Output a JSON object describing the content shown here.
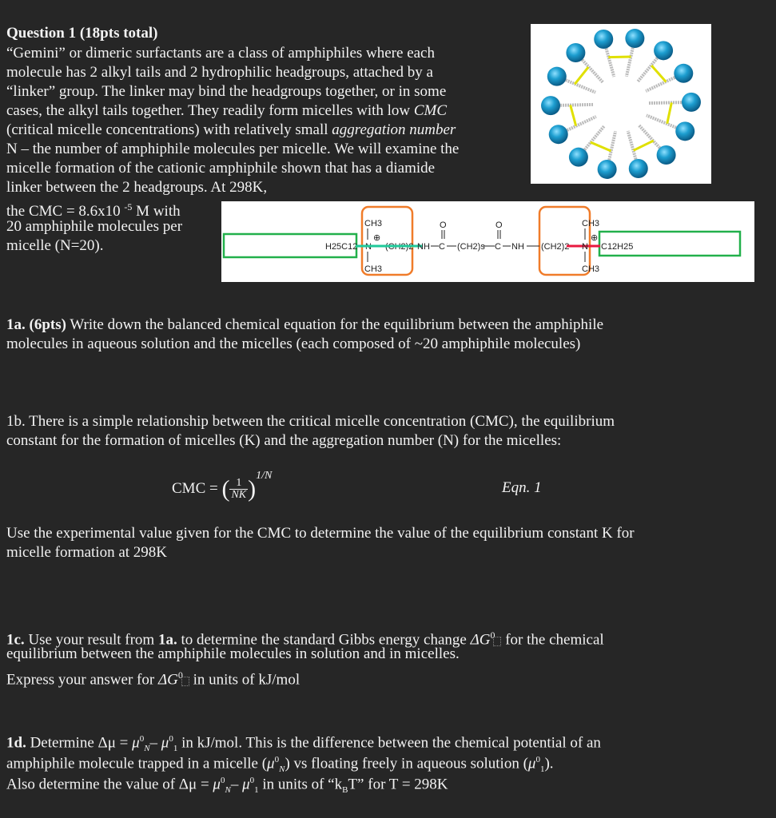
{
  "question": {
    "title": "Question 1 (18pts total)",
    "intro_lines": [
      "“Gemini” or dimeric surfactants are a class of amphiphiles where each",
      "molecule has 2 alkyl tails and 2 hydrophilic headgroups, attached by a",
      "“linker” group. The linker may bind the headgroups together, or in some",
      "cases, the alkyl tails together. They readily form micelles with low ",
      "(critical micelle concentrations) with relatively small ",
      "N – the number of amphiphile molecules per micelle.  We will examine the",
      "micelle formation of the cationic amphiphile shown that has a diamide",
      "linker between the 2 headgroups. At 298K,"
    ],
    "intro_italic": {
      "cmc": "CMC",
      "aggregation": "aggregation number"
    },
    "cmc_line_prefix": "the CMC = 8.6x10 ",
    "cmc_exponent": "-5",
    "cmc_line_suffix": " M with",
    "n_line_1": "20 amphiphile molecules per",
    "n_line_2": "micelle (N=20).",
    "cmc_value": "8.6x10^-5 M",
    "aggregation_number": 20,
    "temperature": "298K"
  },
  "figures": {
    "micelle_image": "gemini-micelle-diagram",
    "molecule": {
      "left_tail": "H25C12",
      "right_tail": "C12H25",
      "methyl": "CH3",
      "nitrogen": "N",
      "charge": "⊕",
      "spacer_left": "(CH2)2",
      "spacer_right": "(CH2)2",
      "amide": "NH",
      "carbonyl_c": "C",
      "carbonyl_o": "O",
      "linker_chain": "(CH2)s",
      "colors": {
        "tail_box": "#22b04b",
        "head_box": "#f07c2a",
        "bond_left": "#1fc99a",
        "bond_right": "#e8193f"
      }
    }
  },
  "part_1a": {
    "label": "1a. (6pts)",
    "lines": [
      " Write down the balanced chemical equation for the equilibrium between the amphiphile",
      "molecules in aqueous solution and the micelles (each composed of ~20 amphiphile molecules)"
    ]
  },
  "part_1b": {
    "lines": [
      "1b. There is a simple relationship between the critical micelle concentration (CMC), the equilibrium",
      "constant for the formation of micelles (K) and the aggregation number (N) for the micelles:"
    ],
    "equation": {
      "lhs": "CMC = ",
      "num": "1",
      "den": "NK",
      "exp": "1/N",
      "label": "Eqn. 1"
    },
    "after_lines": [
      "Use the experimental value given for the CMC to determine the value of the equilibrium constant K for",
      "micelle formation at 298K"
    ]
  },
  "part_1c": {
    "label_1": "1c.",
    "text_1": " Use your result from ",
    "label_ref": "1a.",
    "text_2": " to determine the standard Gibbs energy change ",
    "text_3": " for the chemical",
    "line_2": "equilibrium between the amphiphile molecules in solution and in micelles.",
    "line_3_a": "Express your answer for ",
    "line_3_b": " in units of kJ/mol",
    "dg": "ΔG",
    "dg_sup": "0"
  },
  "part_1d": {
    "label": "1d.",
    "line_1_a": " Determine ",
    "line_1_b": " in kJ/mol. This is the difference between the chemical potential of an",
    "line_2_a": "amphiphile molecule trapped in a micelle (",
    "line_2_b": ") vs floating freely in aqueous solution (",
    "line_2_c": ").",
    "line_3_a": "Also determine the value of ",
    "line_3_b": " in units of “k",
    "line_3_sub": "B",
    "line_3_c": "T” for T = 298K",
    "dmu": "Δμ = ",
    "mu": "μ",
    "sup0": "0",
    "subN": "N",
    "sub1": "1",
    "minus": "– "
  }
}
